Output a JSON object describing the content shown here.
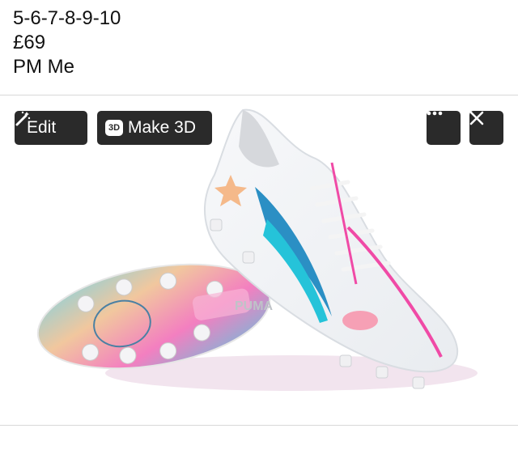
{
  "post": {
    "sizes": "5-6-7-8-9-10",
    "price": "£69",
    "contact": "PM Me"
  },
  "toolbar": {
    "edit_label": "Edit",
    "make3d_badge": "3D",
    "make3d_label": "Make 3D",
    "more_icon": "more-horizontal-icon",
    "close_icon": "close-icon"
  },
  "photo": {
    "description_brand": "PUMA"
  },
  "colors": {
    "button_bg": "#2a2a2a",
    "divider": "#d8d8d8"
  }
}
